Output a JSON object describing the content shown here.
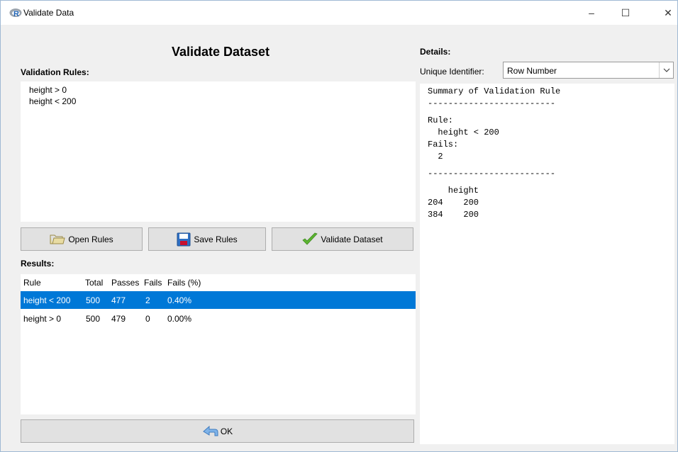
{
  "window": {
    "title": "Validate Data",
    "icon": "r-logo-icon",
    "controls": {
      "minimize": "–",
      "maximize": "☐",
      "close": "✕"
    }
  },
  "main": {
    "title": "Validate Dataset",
    "rules_label": "Validation Rules:",
    "rules": [
      "height > 0",
      "height < 200"
    ],
    "buttons": {
      "open": "Open Rules",
      "save": "Save Rules",
      "validate": "Validate Dataset",
      "ok": "OK"
    },
    "results_label": "Results:",
    "results": {
      "headers": [
        "Rule",
        "Total",
        "Passes",
        "Fails",
        "Fails (%)"
      ],
      "rows": [
        {
          "rule": "height < 200",
          "total": "500",
          "passes": "477",
          "fails": "2",
          "fails_pct": "0.40%",
          "selected": true
        },
        {
          "rule": "height > 0",
          "total": "500",
          "passes": "479",
          "fails": "0",
          "fails_pct": "0.00%",
          "selected": false
        }
      ]
    }
  },
  "details": {
    "label": "Details:",
    "unique_identifier_label": "Unique Identifier:",
    "unique_identifier_value": "Row Number",
    "summary": {
      "heading": "Summary of Validation Rule",
      "separator": "-------------------------",
      "rule_label": "Rule:",
      "rule_value": "  height < 200",
      "fails_label": "Fails:",
      "fails_value": "  2",
      "column_header": "    height",
      "rows": [
        "204    200",
        "384    200"
      ]
    }
  },
  "colors": {
    "selection": "#0078d7",
    "window_bg": "#f0f0f0",
    "button_bg": "#e1e1e1",
    "check_green": "#5cb531"
  }
}
